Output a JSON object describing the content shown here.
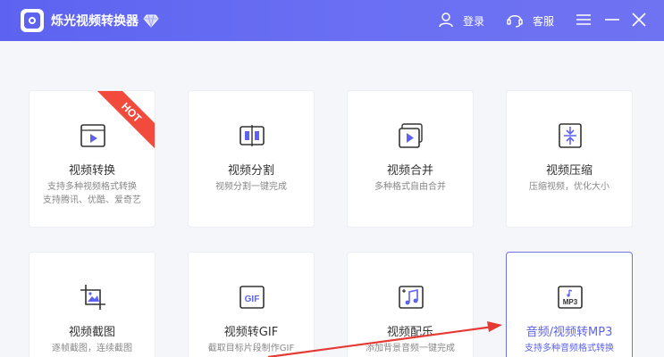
{
  "app": {
    "title": "烁光视频转换器",
    "login_label": "登录",
    "service_label": "客服",
    "accent_color": "#5d63f0"
  },
  "cards": [
    {
      "title": "视频转换",
      "desc": [
        "支持多种视频格式转换",
        "支持腾讯、优酷、爱奇艺"
      ],
      "icon": "video-play-icon",
      "badge": "HOT"
    },
    {
      "title": "视频分割",
      "desc": [
        "视频分割一键完成"
      ],
      "icon": "split-icon"
    },
    {
      "title": "视频合并",
      "desc": [
        "多种格式自由合并"
      ],
      "icon": "merge-icon"
    },
    {
      "title": "视频压缩",
      "desc": [
        "压缩视频，优化大小"
      ],
      "icon": "compress-icon"
    },
    {
      "title": "视频截图",
      "desc": [
        "逐帧截图，连续截图"
      ],
      "icon": "screenshot-icon"
    },
    {
      "title": "视频转GIF",
      "desc": [
        "截取目标片段制作GIF"
      ],
      "icon": "gif-icon"
    },
    {
      "title": "视频配乐",
      "desc": [
        "添加背景音频一键完成"
      ],
      "icon": "music-icon"
    },
    {
      "title": "音频/视频转MP3",
      "desc": [
        "支持多种音频格式转换"
      ],
      "icon": "mp3-icon",
      "selected": true
    }
  ],
  "colors": {
    "titlebar": "#5d63f0",
    "hot_badge": "#f24a3d",
    "annotation_arrow": "#e53935"
  }
}
